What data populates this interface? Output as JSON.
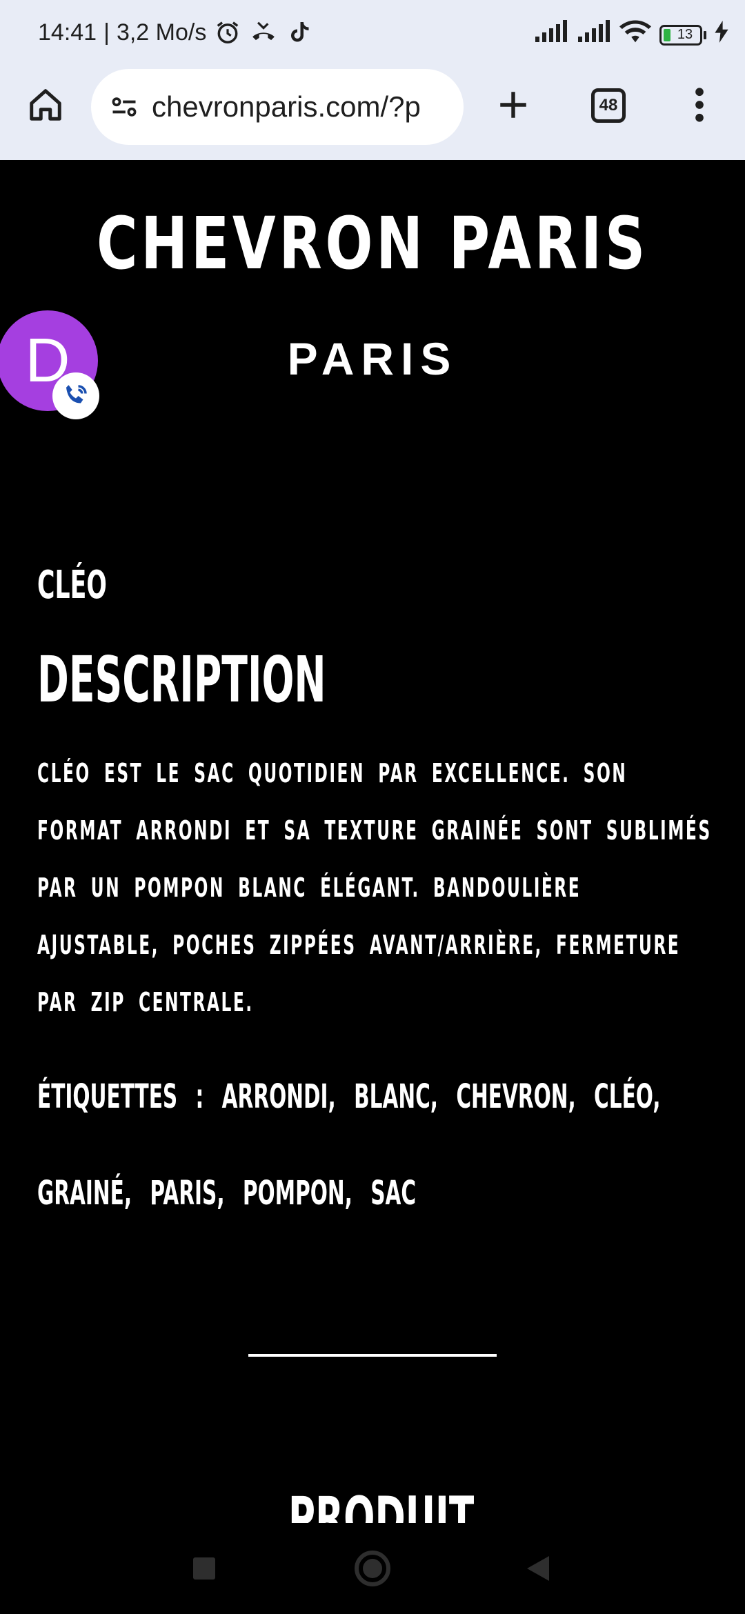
{
  "status_bar": {
    "time": "14:41",
    "separator": "|",
    "speed": "3,2 Mo/s",
    "battery": "13"
  },
  "browser": {
    "url": "chevronparis.com/?p",
    "tab_count": "48"
  },
  "page": {
    "brand": "CHEVRON PARIS",
    "sub_brand": "PARIS",
    "avatar_letter": "D",
    "product_name": "CLÉO",
    "description_heading": "DESCRIPTION",
    "description_text": "CLÉO EST LE SAC QUOTIDIEN PAR EXCELLENCE. SON FORMAT ARRONDI ET SA TEXTURE GRAINÉE SONT SUBLIMÉS PAR UN POMPON BLANC ÉLÉGANT. BANDOULIÈRE AJUSTABLE, POCHES ZIPPÉES AVANT/ARRIÈRE, FERMETURE PAR ZIP CENTRALE.",
    "tags_label": "ÉTIQUETTES :",
    "tags": [
      "ARRONDI,",
      "BLANC,",
      "CHEVRON,",
      "CLÉO,",
      "GRAINÉ,",
      "PARIS,",
      "POMPON,",
      "SAC"
    ],
    "next_heading": "PRODUIT"
  },
  "colors": {
    "page_background": "#000000",
    "chrome_background": "#e8ecf6",
    "avatar": "#a53fe0"
  }
}
